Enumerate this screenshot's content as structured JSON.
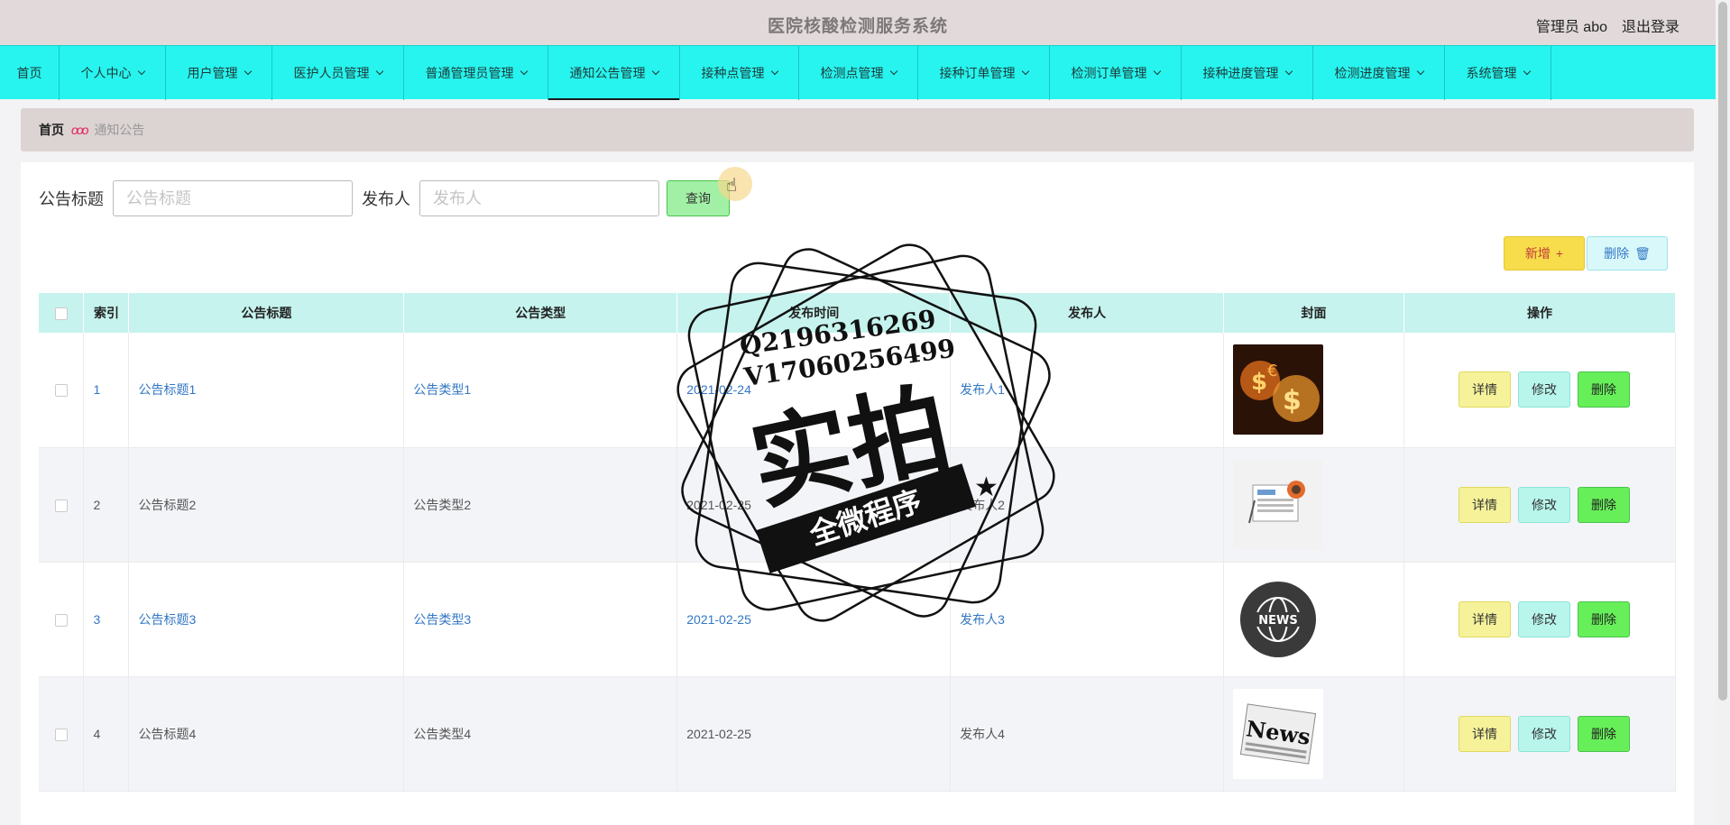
{
  "header": {
    "title": "医院核酸检测服务系统",
    "admin": "管理员 abo",
    "logout": "退出登录"
  },
  "nav": [
    {
      "label": "首页",
      "chevron": false
    },
    {
      "label": "个人中心",
      "chevron": true
    },
    {
      "label": "用户管理",
      "chevron": true
    },
    {
      "label": "医护人员管理",
      "chevron": true
    },
    {
      "label": "普通管理员管理",
      "chevron": true
    },
    {
      "label": "通知公告管理",
      "chevron": true,
      "active": true
    },
    {
      "label": "接种点管理",
      "chevron": true
    },
    {
      "label": "检测点管理",
      "chevron": true
    },
    {
      "label": "接种订单管理",
      "chevron": true
    },
    {
      "label": "检测订单管理",
      "chevron": true
    },
    {
      "label": "接种进度管理",
      "chevron": true
    },
    {
      "label": "检测进度管理",
      "chevron": true
    },
    {
      "label": "系统管理",
      "chevron": true
    }
  ],
  "breadcrumb": {
    "home": "首页",
    "separator": "ooo",
    "current": "通知公告"
  },
  "search": {
    "title_label": "公告标题",
    "title_placeholder": "公告标题",
    "publisher_label": "发布人",
    "publisher_placeholder": "发布人",
    "button": "查询"
  },
  "actions": {
    "add": "新增",
    "add_icon": "+",
    "delete": "删除",
    "delete_icon": "🗑"
  },
  "table": {
    "columns": [
      "",
      "索引",
      "公告标题",
      "公告类型",
      "发布时间",
      "发布人",
      "封面",
      "操作"
    ],
    "rows": [
      {
        "index": "1",
        "title": "公告标题1",
        "type": "公告类型1",
        "time": "2021-02-24",
        "publisher": "发布人1",
        "cover": "money-cover-icon",
        "linked": true
      },
      {
        "index": "2",
        "title": "公告标题2",
        "type": "公告类型2",
        "time": "2021-02-25",
        "publisher": "发布人2",
        "cover": "newspaper-cover-icon",
        "linked": false
      },
      {
        "index": "3",
        "title": "公告标题3",
        "type": "公告类型3",
        "time": "2021-02-25",
        "publisher": "发布人3",
        "cover": "globe-news-cover-icon",
        "linked": true
      },
      {
        "index": "4",
        "title": "公告标题4",
        "type": "公告类型4",
        "time": "2021-02-25",
        "publisher": "发布人4",
        "cover": "news-paper-cover-icon",
        "linked": false
      }
    ],
    "ops": {
      "detail": "详情",
      "edit": "修改",
      "remove": "删除"
    }
  },
  "watermark": {
    "line1": "Q2196316269",
    "line2": "V17060256499",
    "main": "实拍",
    "banner": "全微程序"
  }
}
